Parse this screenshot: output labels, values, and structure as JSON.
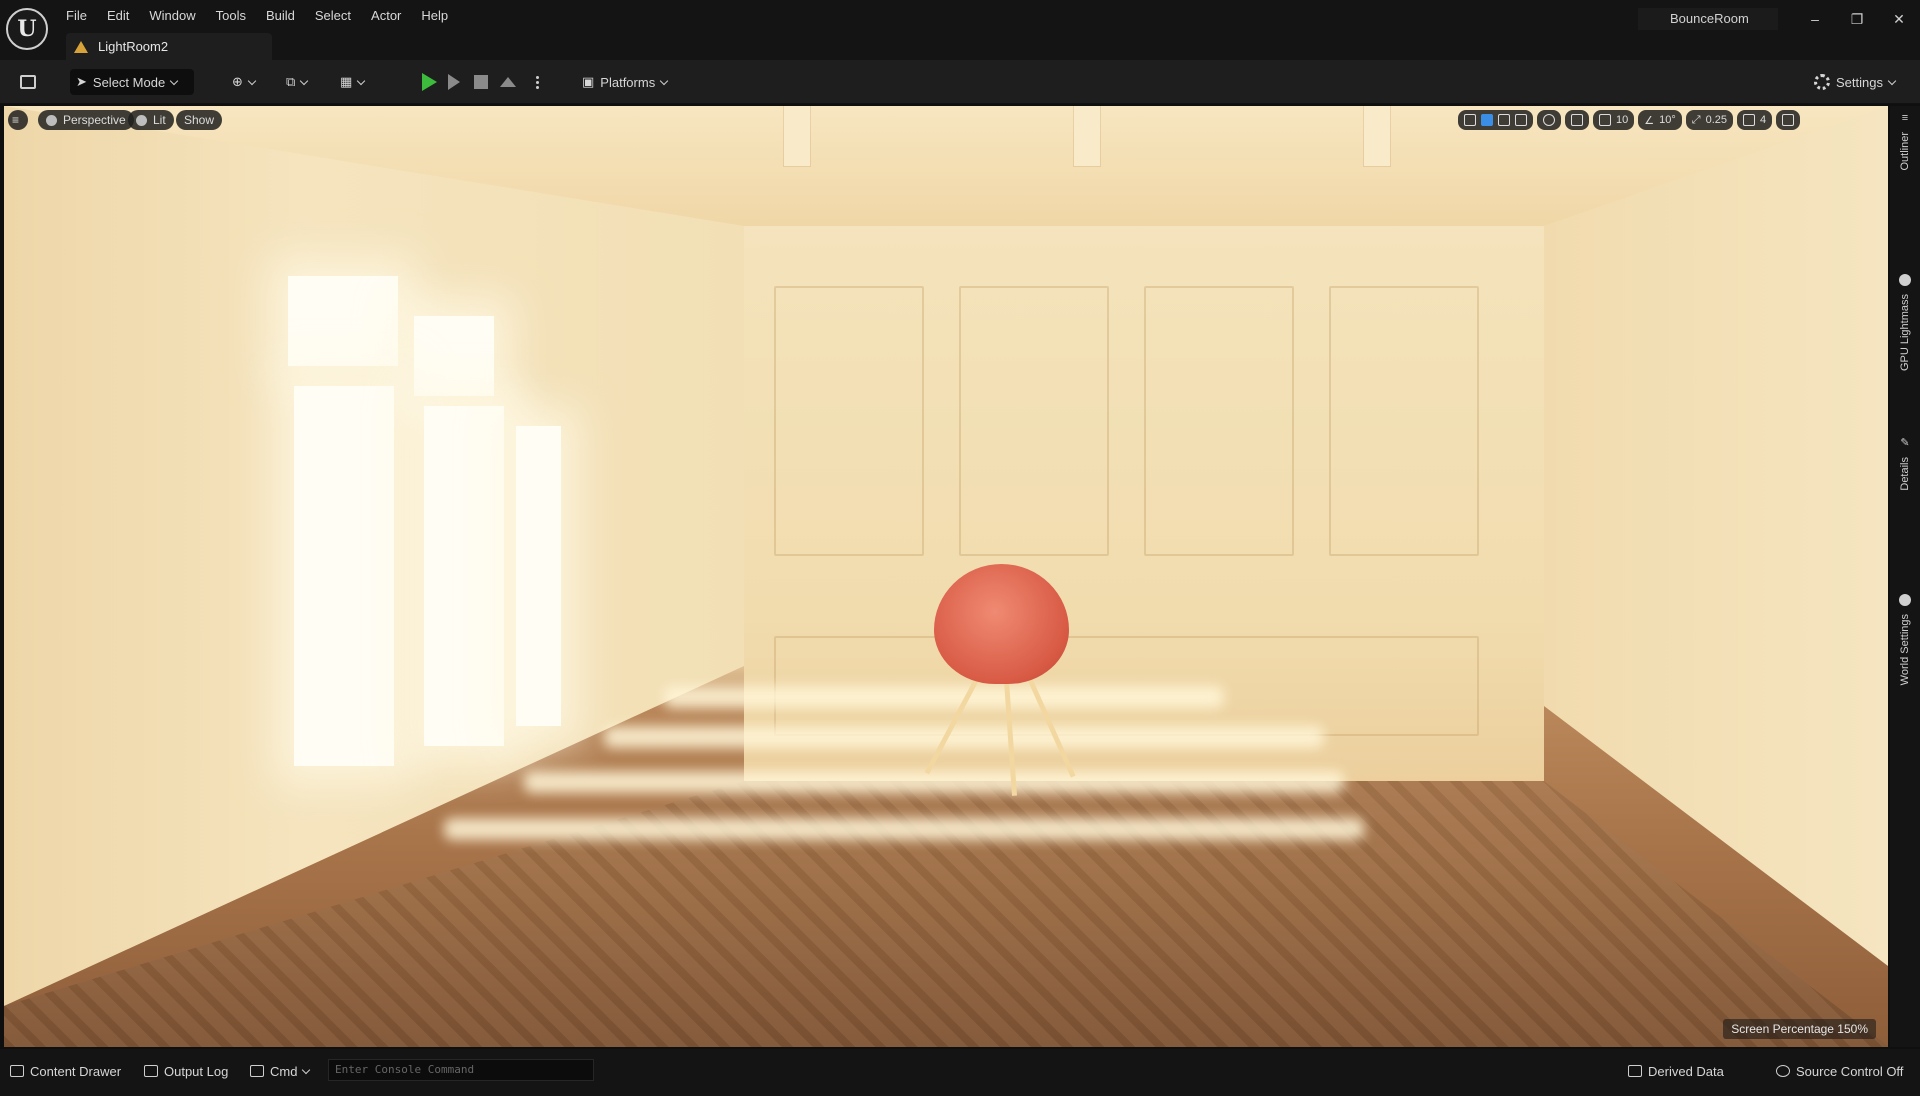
{
  "app": {
    "logo_text": "U",
    "menus": [
      "File",
      "Edit",
      "Window",
      "Tools",
      "Build",
      "Select",
      "Actor",
      "Help"
    ],
    "document_tab": "LightRoom2",
    "project_name": "BounceRoom",
    "window_controls": [
      "–",
      "❐",
      "✕"
    ]
  },
  "toolbar": {
    "select_mode": "Select Mode",
    "platforms": "Platforms",
    "settings": "Settings"
  },
  "viewport": {
    "perspective": "Perspective",
    "lit": "Lit",
    "show": "Show",
    "grid_snap": "10",
    "rotation_snap": "10°",
    "scale_snap": "0.25",
    "camera_speed": "4",
    "screen_percentage": "Screen Percentage  150%"
  },
  "side_tabs": [
    "Outliner",
    "GPU Lightmass",
    "Details",
    "World Settings"
  ],
  "statusbar": {
    "content_drawer": "Content Drawer",
    "output_log": "Output Log",
    "cmd": "Cmd",
    "console_placeholder": "Enter Console Command",
    "derived_data": "Derived Data",
    "source_control": "Source Control Off"
  },
  "colors": {
    "play_green": "#3dbb3d",
    "accent_blue": "#3a8ee6",
    "chair_orange": "#d85a45",
    "tab_warning": "#d8a23a"
  }
}
